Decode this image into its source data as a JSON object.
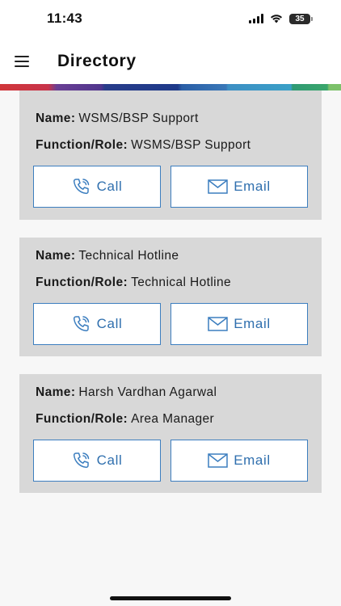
{
  "status_bar": {
    "time": "11:43",
    "battery": "35"
  },
  "header": {
    "title": "Directory"
  },
  "labels": {
    "name": "Name:",
    "role": "Function/Role:"
  },
  "contacts": [
    {
      "name": "WSMS/BSP Support",
      "role": "WSMS/BSP Support",
      "call_label": "Call",
      "email_label": "Email"
    },
    {
      "name": "Technical Hotline",
      "role": "Technical Hotline",
      "call_label": "Call",
      "email_label": "Email"
    },
    {
      "name": "Harsh Vardhan Agarwal",
      "role": "Area Manager",
      "call_label": "Call",
      "email_label": "Email"
    }
  ],
  "icons": {
    "menu": "hamburger-menu-icon",
    "call": "phone-icon",
    "email": "envelope-icon"
  },
  "colors": {
    "accent": "#3c7ebf",
    "card_bg": "#d8d8d8",
    "page_bg": "#f7f7f7"
  }
}
